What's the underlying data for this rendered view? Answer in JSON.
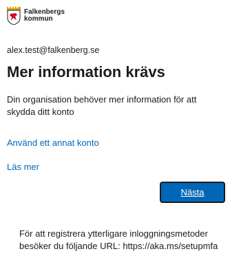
{
  "logo": {
    "line1": "Falkenbergs",
    "line2": "kommun",
    "icon": "falkenberg-coat-of-arms-icon"
  },
  "account": {
    "email": "alex.test@falkenberg.se"
  },
  "page": {
    "title": "Mer information krävs",
    "description": "Din organisation behöver mer information för att skydda ditt konto"
  },
  "links": {
    "other_account": "Använd ett annat konto",
    "read_more": "Läs mer"
  },
  "buttons": {
    "next": "Nästa"
  },
  "info": {
    "text": "För att registrera ytterligare inloggningsmetoder besöker du följande URL: https://aka.ms/setupmfa"
  },
  "colors": {
    "accent": "#0067b8",
    "text": "#1b1b1b",
    "logo_red": "#c8102e",
    "logo_gold": "#d9a400"
  }
}
